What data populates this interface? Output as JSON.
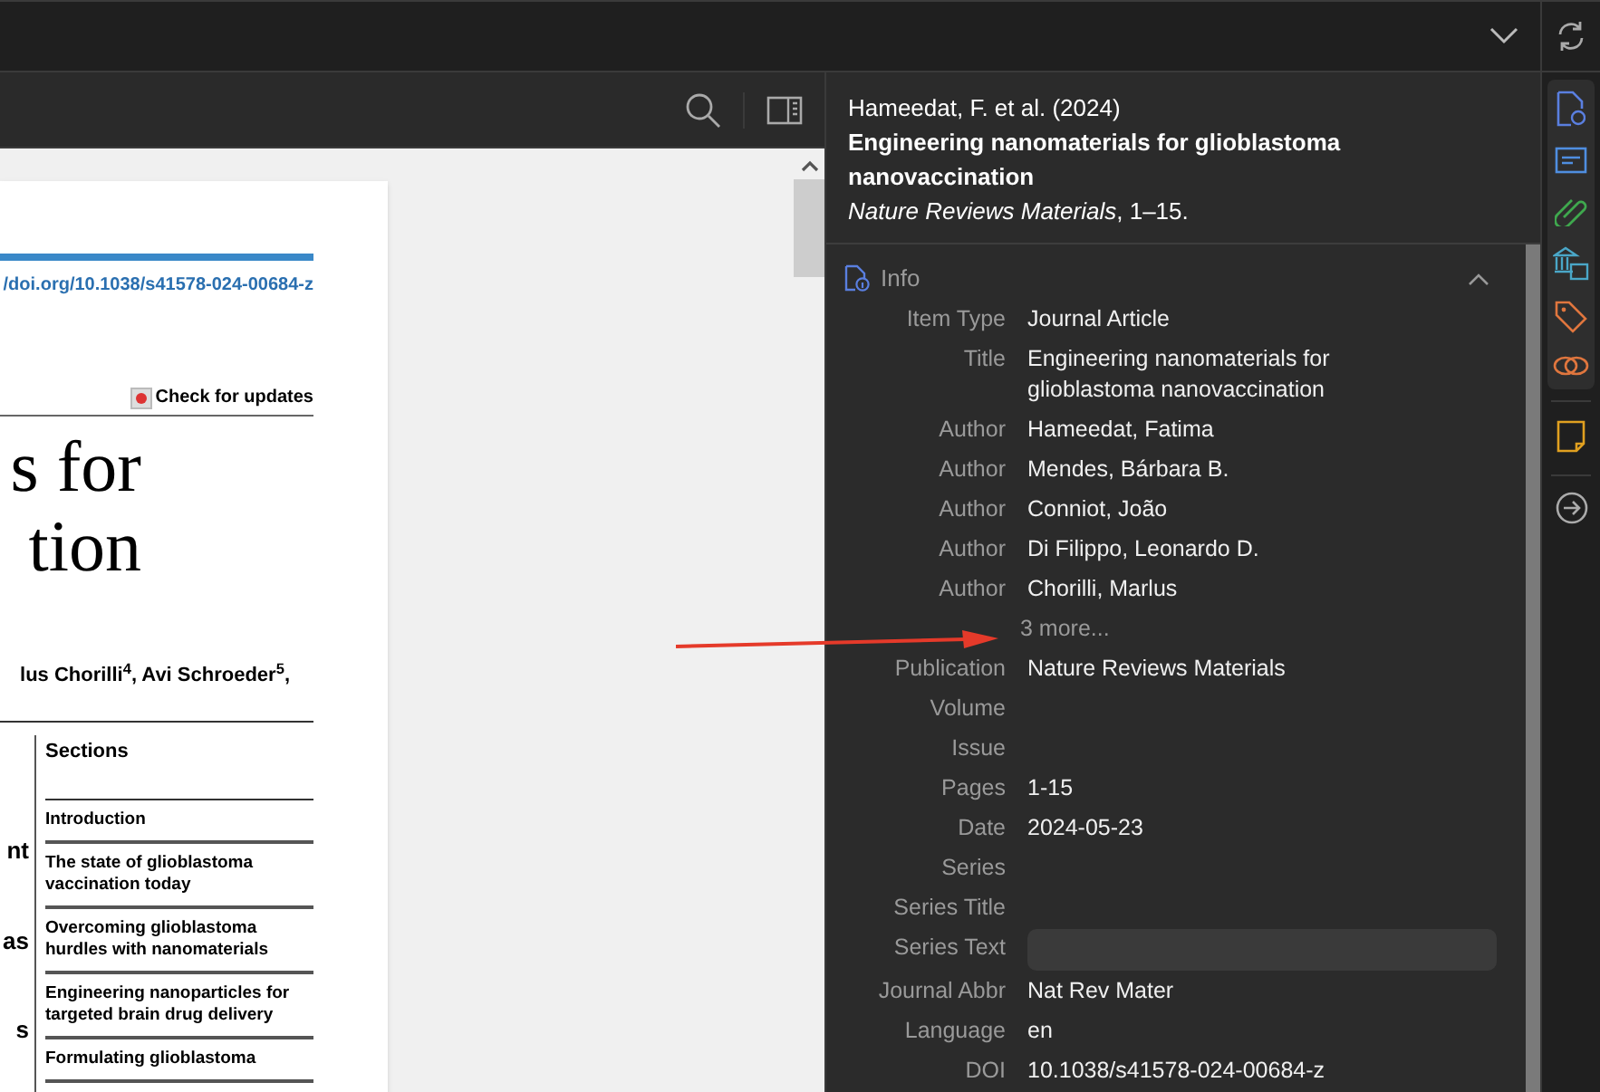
{
  "pdf_page": {
    "doi_link": "/doi.org/10.1038/s41578-024-00684-z",
    "check_updates": "Check for updates",
    "title_lines": [
      "s for",
      "tion"
    ],
    "authors": "lus Chorilli$^{4}$, Avi Schroeder$^{5}$,",
    "column_1": [
      "nt",
      "as",
      "s"
    ],
    "sections_heading": "Sections",
    "sections": [
      "Introduction",
      "The state of glioblastoma vaccination today",
      "Overcoming glioblastoma hurdles with nanomaterials",
      "Engineering nanoparticles for targeted brain drug delivery",
      "Formulating glioblastoma"
    ]
  },
  "citation": {
    "authors": "Hameedat, F. et al. (2024)",
    "title": "Engineering nanomaterials for glioblastoma nanovaccination",
    "journal": "Nature Reviews Materials",
    "pages": ", 1–15."
  },
  "info": {
    "heading": "Info",
    "expanded": true,
    "fields": [
      {
        "label": "Item Type",
        "value": "Journal Article",
        "kind": "text"
      },
      {
        "label": "Title",
        "value": "Engineering nanomaterials for glioblastoma nanovaccination",
        "kind": "text"
      },
      {
        "label": "Author",
        "value": "Hameedat, Fatima",
        "kind": "text"
      },
      {
        "label": "Author",
        "value": "Mendes, Bárbara B.",
        "kind": "text"
      },
      {
        "label": "Author",
        "value": "Conniot, João",
        "kind": "text"
      },
      {
        "label": "Author",
        "value": "Di Filippo, Leonardo D.",
        "kind": "text"
      },
      {
        "label": "Author",
        "value": "Chorilli, Marlus",
        "kind": "text"
      },
      {
        "value": "3 more...",
        "kind": "more"
      },
      {
        "label": "Publication",
        "value": "Nature Reviews Materials",
        "kind": "text"
      },
      {
        "label": "Volume",
        "kind": "text"
      },
      {
        "label": "Issue",
        "kind": "text"
      },
      {
        "label": "Pages",
        "value": "1-15",
        "kind": "text"
      },
      {
        "label": "Date",
        "value": "2024-05-23",
        "kind": "text"
      },
      {
        "label": "Series",
        "kind": "text"
      },
      {
        "label": "Series Title",
        "kind": "text"
      },
      {
        "label": "Series Text",
        "kind": "input"
      },
      {
        "label": "Journal Abbr",
        "value": "Nat Rev Mater",
        "kind": "text"
      },
      {
        "label": "Language",
        "value": "en",
        "kind": "text"
      },
      {
        "label": "DOI",
        "value": "10.1038/s41578-024-00684-z",
        "kind": "text"
      }
    ]
  }
}
